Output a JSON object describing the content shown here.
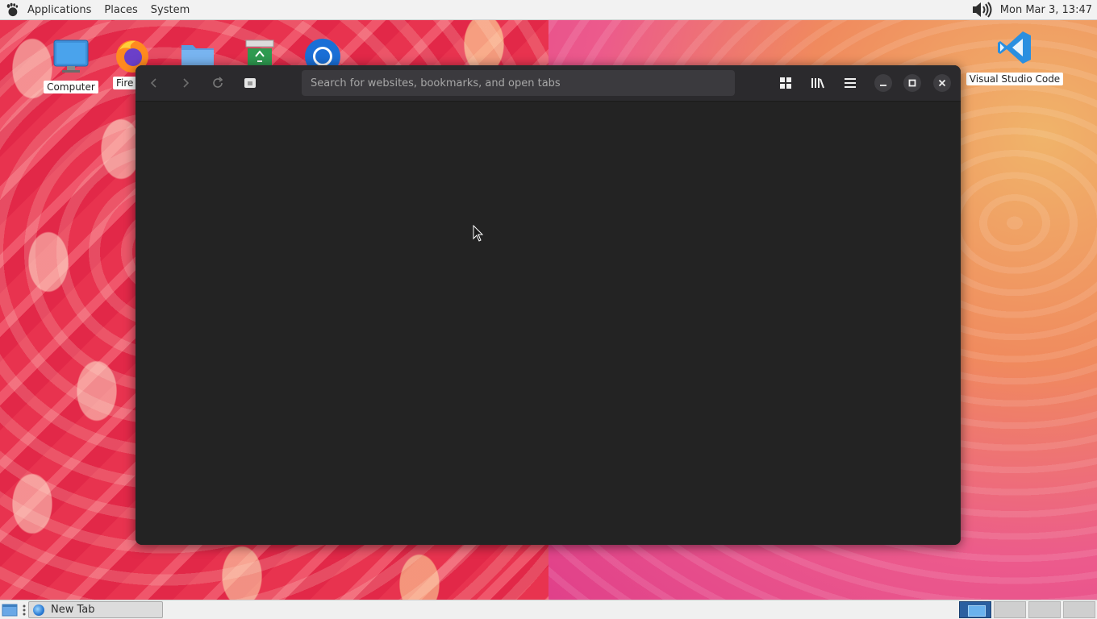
{
  "top_panel": {
    "menus": [
      "Applications",
      "Places",
      "System"
    ],
    "clock": "Mon Mar  3, 13:47"
  },
  "desktop": {
    "icons": [
      {
        "label": "Computer",
        "icon": "computer-icon"
      },
      {
        "label": "Fire",
        "icon": "firefox-icon"
      },
      {
        "label": "",
        "icon": "home-folder-icon"
      },
      {
        "label": "",
        "icon": "trash-icon"
      },
      {
        "label": "",
        "icon": "chrome-icon"
      },
      {
        "label": "Visual Studio Code",
        "icon": "vscode-icon"
      }
    ]
  },
  "browser": {
    "search_placeholder": "Search for websites, bookmarks, and open tabs",
    "toolbar_icons": [
      "back-icon",
      "forward-icon",
      "reload-icon",
      "page-icon",
      "grid-icon",
      "library-icon",
      "menu-icon",
      "minimize-icon",
      "maximize-icon",
      "close-icon"
    ]
  },
  "bottom_panel": {
    "task_label": "New Tab",
    "workspaces": 4,
    "active_workspace": 1
  },
  "colors": {
    "browser_bg": "#232323",
    "toolbar_bg": "#2b2a2d",
    "urlbar_bg": "#3b3a3e",
    "panel_bg": "#f2f2f2",
    "workspace_active": "#2a5fa0"
  }
}
